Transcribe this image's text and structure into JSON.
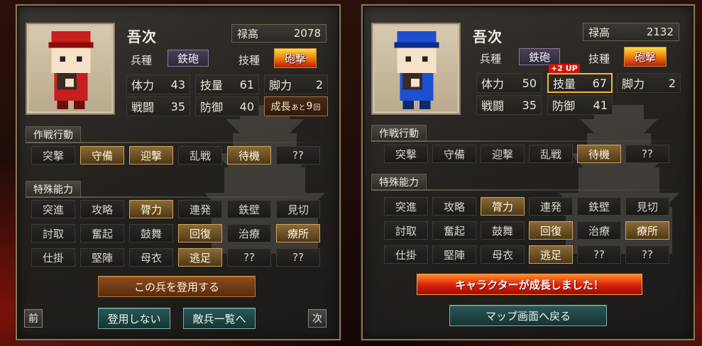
{
  "panels": [
    {
      "name": "吾次",
      "salary_label": "禄高",
      "salary": "2078",
      "unit_label": "兵種",
      "unit": "鉄砲",
      "tech_label": "技種",
      "tech": "砲撃",
      "stats": {
        "hp_label": "体力",
        "hp": "43",
        "skill_label": "技量",
        "skill": "61",
        "speed_label": "脚力",
        "speed": "2",
        "atk_label": "戦闘",
        "atk": "35",
        "def_label": "防御",
        "def": "40"
      },
      "growth": {
        "prefix": "成長",
        "mid": "あと",
        "count": "9",
        "suffix": "回"
      },
      "tactics_title": "作戦行動",
      "tactics": [
        {
          "label": "突撃",
          "on": false
        },
        {
          "label": "守備",
          "on": true
        },
        {
          "label": "迎撃",
          "on": true
        },
        {
          "label": "乱戦",
          "on": false
        },
        {
          "label": "待機",
          "on": true
        },
        {
          "label": "??",
          "on": false
        }
      ],
      "abilities_title": "特殊能力",
      "abilities": [
        {
          "label": "突進",
          "on": false
        },
        {
          "label": "攻略",
          "on": false
        },
        {
          "label": "膂力",
          "on": true
        },
        {
          "label": "連発",
          "on": false
        },
        {
          "label": "鉄壁",
          "on": false
        },
        {
          "label": "見切",
          "on": false
        },
        {
          "label": "討取",
          "on": false
        },
        {
          "label": "奮起",
          "on": false
        },
        {
          "label": "鼓舞",
          "on": false
        },
        {
          "label": "回復",
          "on": true
        },
        {
          "label": "治療",
          "on": false
        },
        {
          "label": "療所",
          "on": true
        },
        {
          "label": "仕掛",
          "on": false
        },
        {
          "label": "堅陣",
          "on": false
        },
        {
          "label": "母衣",
          "on": false
        },
        {
          "label": "逃足",
          "on": true
        },
        {
          "label": "??",
          "on": false
        },
        {
          "label": "??",
          "on": false
        }
      ],
      "buttons": {
        "recruit": "この兵を登用する",
        "prev": "前",
        "next": "次",
        "decline": "登用しない",
        "enemy_list": "敵兵一覧へ"
      }
    },
    {
      "name": "吾次",
      "salary_label": "禄高",
      "salary": "2132",
      "unit_label": "兵種",
      "unit": "鉄砲",
      "tech_label": "技種",
      "tech": "砲撃",
      "up_badge": "+2 UP",
      "stats": {
        "hp_label": "体力",
        "hp": "50",
        "skill_label": "技量",
        "skill": "67",
        "speed_label": "脚力",
        "speed": "2",
        "atk_label": "戦闘",
        "atk": "35",
        "def_label": "防御",
        "def": "41"
      },
      "tactics_title": "作戦行動",
      "tactics": [
        {
          "label": "突撃",
          "on": false
        },
        {
          "label": "守備",
          "on": false
        },
        {
          "label": "迎撃",
          "on": false
        },
        {
          "label": "乱戦",
          "on": false
        },
        {
          "label": "待機",
          "on": true
        },
        {
          "label": "??",
          "on": false
        }
      ],
      "abilities_title": "特殊能力",
      "abilities": [
        {
          "label": "突進",
          "on": false
        },
        {
          "label": "攻略",
          "on": false
        },
        {
          "label": "膂力",
          "on": true
        },
        {
          "label": "連発",
          "on": false
        },
        {
          "label": "鉄壁",
          "on": false
        },
        {
          "label": "見切",
          "on": false
        },
        {
          "label": "討取",
          "on": false
        },
        {
          "label": "奮起",
          "on": false
        },
        {
          "label": "鼓舞",
          "on": false
        },
        {
          "label": "回復",
          "on": true
        },
        {
          "label": "治療",
          "on": false
        },
        {
          "label": "療所",
          "on": true
        },
        {
          "label": "仕掛",
          "on": false
        },
        {
          "label": "堅陣",
          "on": false
        },
        {
          "label": "母衣",
          "on": false
        },
        {
          "label": "逃足",
          "on": true
        },
        {
          "label": "??",
          "on": false
        },
        {
          "label": "??",
          "on": false
        }
      ],
      "banner": "キャラクターが成長しました！",
      "buttons": {
        "map": "マップ画面へ戻る"
      }
    }
  ],
  "colors": {
    "left_uniform": "#c81e1e",
    "right_uniform": "#1e4ed2",
    "accent_gold": "#f3b638"
  }
}
